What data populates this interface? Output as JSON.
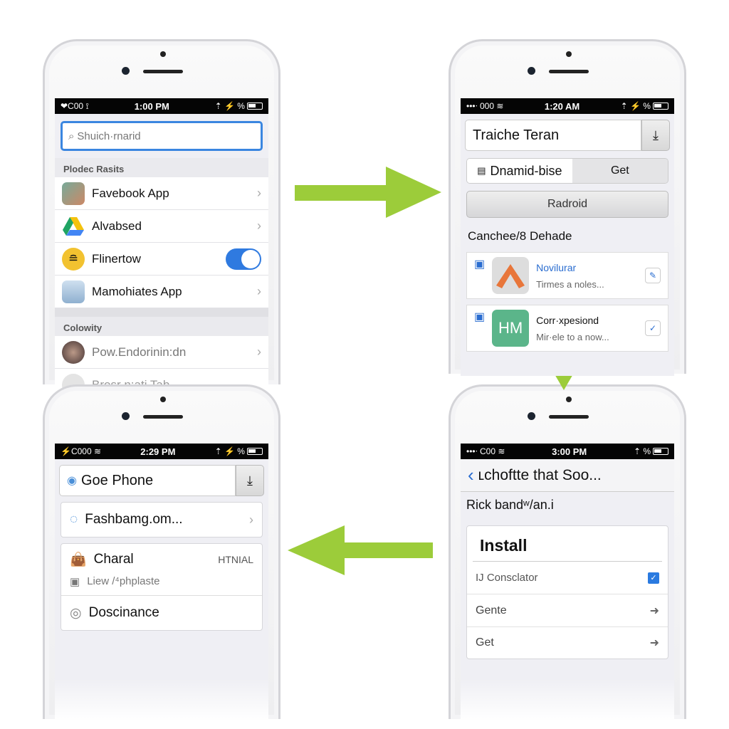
{
  "accent": "#3a86e0",
  "arrow_color": "#9ccc3a",
  "phone1": {
    "status": {
      "carrier": "❤C00 ⟟",
      "time": "1:00 PM",
      "icons": "⇡ ⚡ %"
    },
    "search": {
      "placeholder": "Shuich·rnarid",
      "icon": "search-icon"
    },
    "section1": "Plodec Rasits",
    "rows": [
      {
        "label": "Favebook App",
        "accessory": "chevron"
      },
      {
        "label": "Alvabsed",
        "accessory": "chevron"
      },
      {
        "label": "Flinertow",
        "accessory": "toggle",
        "toggle_on": true
      },
      {
        "label": "Mamohiates App",
        "accessory": "chevron"
      }
    ],
    "section2": "Colowity",
    "rows2": [
      {
        "label": "Pow.Endorinin:dn"
      },
      {
        "label": "Brosr n:ati Tab"
      }
    ]
  },
  "phone2": {
    "status": {
      "carrier": "•••ᐧ 000 ≋",
      "time": "1:20 AM",
      "icons": "⇡ ⚡ %"
    },
    "field": "Traiche Teran",
    "segment": {
      "left": "Dnamid-bise",
      "right": "Get"
    },
    "button": "Radroid",
    "section": "Canchee/8 Dehade",
    "cards": [
      {
        "title": "Novilurar",
        "subtitle": "Tirmes a noles..."
      },
      {
        "title": "Corr·xpesiond",
        "subtitle": "Mir·ele to a now..."
      }
    ]
  },
  "phone3": {
    "status": {
      "carrier": "⚡C000 ≋",
      "time": "2:29 PM",
      "icons": "⇡ ⚡ %"
    },
    "field": "Goe Phone",
    "link": "Fashbamg.om...",
    "item": {
      "title": "Charal",
      "badge": "HTNIAL",
      "subtitle": "Liew /⁴phplaste"
    },
    "item2": "Doscinance"
  },
  "phone4": {
    "status": {
      "carrier": "•••ᐧ C00 ≋",
      "time": "3:00 PM",
      "icons": "⇡ %"
    },
    "nav_title": "ʟchoftte that Soo...",
    "label": "Rick bandʷ/an.i",
    "install": {
      "title": "Install",
      "rows": [
        {
          "label": "IJ Consclator",
          "accessory": "checkbox",
          "checked": true
        },
        {
          "label": "Gente",
          "accessory": "arrow"
        },
        {
          "label": "Get",
          "accessory": "arrow"
        }
      ]
    }
  }
}
